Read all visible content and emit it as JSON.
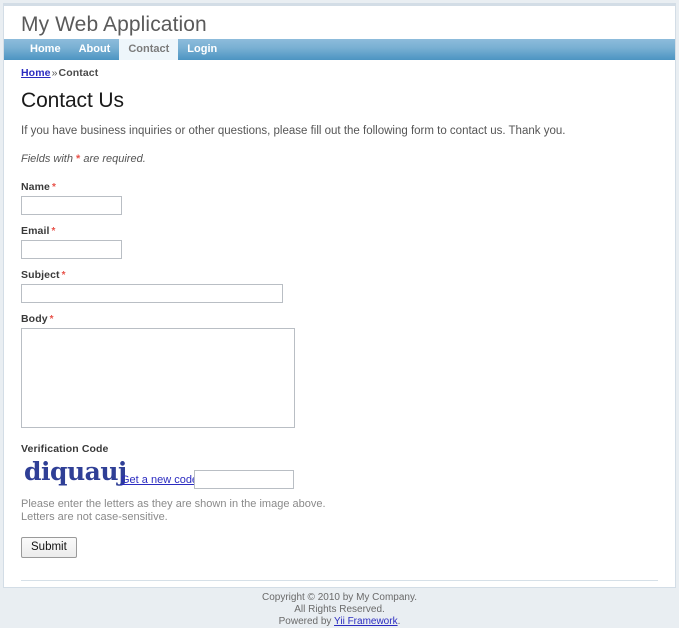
{
  "header": {
    "site_title": "My Web Application"
  },
  "mainmenu": {
    "items": [
      {
        "label": "Home",
        "active": false
      },
      {
        "label": "About",
        "active": false
      },
      {
        "label": "Contact",
        "active": true
      },
      {
        "label": "Login",
        "active": false
      }
    ]
  },
  "breadcrumbs": {
    "home_label": "Home",
    "separator": "»",
    "current_label": "Contact"
  },
  "content": {
    "page_title": "Contact Us",
    "intro": "If you have business inquiries or other questions, please fill out the following form to contact us. Thank you.",
    "note_before": "Fields with",
    "note_asterisk": "*",
    "note_after": "are required."
  },
  "form": {
    "name": {
      "label": "Name",
      "required_mark": "*",
      "value": "",
      "placeholder": ""
    },
    "email": {
      "label": "Email",
      "required_mark": "*",
      "value": "",
      "placeholder": ""
    },
    "subject": {
      "label": "Subject",
      "required_mark": "*",
      "value": "",
      "placeholder": ""
    },
    "body": {
      "label": "Body",
      "required_mark": "*",
      "value": "",
      "placeholder": ""
    },
    "captcha": {
      "label": "Verification Code",
      "image_text": "diquauj",
      "refresh_link_label": "Get a new code",
      "value": "",
      "placeholder": "",
      "hint_line1": "Please enter the letters as they are shown in the image above.",
      "hint_line2": "Letters are not case-sensitive."
    },
    "submit_label": "Submit"
  },
  "footer": {
    "line1": "Copyright © 2010 by My Company.",
    "line2": "All Rights Reserved.",
    "powered_prefix": "Powered by",
    "powered_link": "Yii Framework",
    "powered_suffix": "."
  },
  "colors": {
    "nav_blue_top": "#8dbcdc",
    "nav_blue_bottom": "#4c94c2",
    "active_tab_bg": "#eef6fb",
    "link_blue": "#2b2bc0",
    "required_red": "#e8524a",
    "captcha_blue": "#2f3f96",
    "page_outer_bg": "#e9eef2"
  }
}
